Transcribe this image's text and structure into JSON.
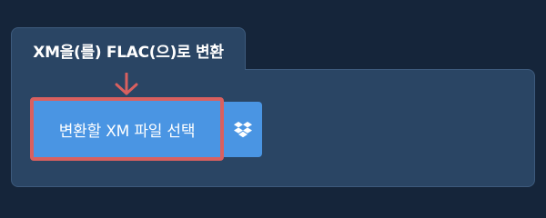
{
  "tab": {
    "title": "XM을(를) FLAC(으)로 변환"
  },
  "upload": {
    "button_label": "변환할 XM 파일 선택",
    "dropbox_icon": "dropbox-icon",
    "arrow_icon": "arrow-down-icon"
  },
  "colors": {
    "background": "#15253a",
    "panel": "#2a4564",
    "button": "#4a95e3",
    "highlight": "#d9605f"
  }
}
